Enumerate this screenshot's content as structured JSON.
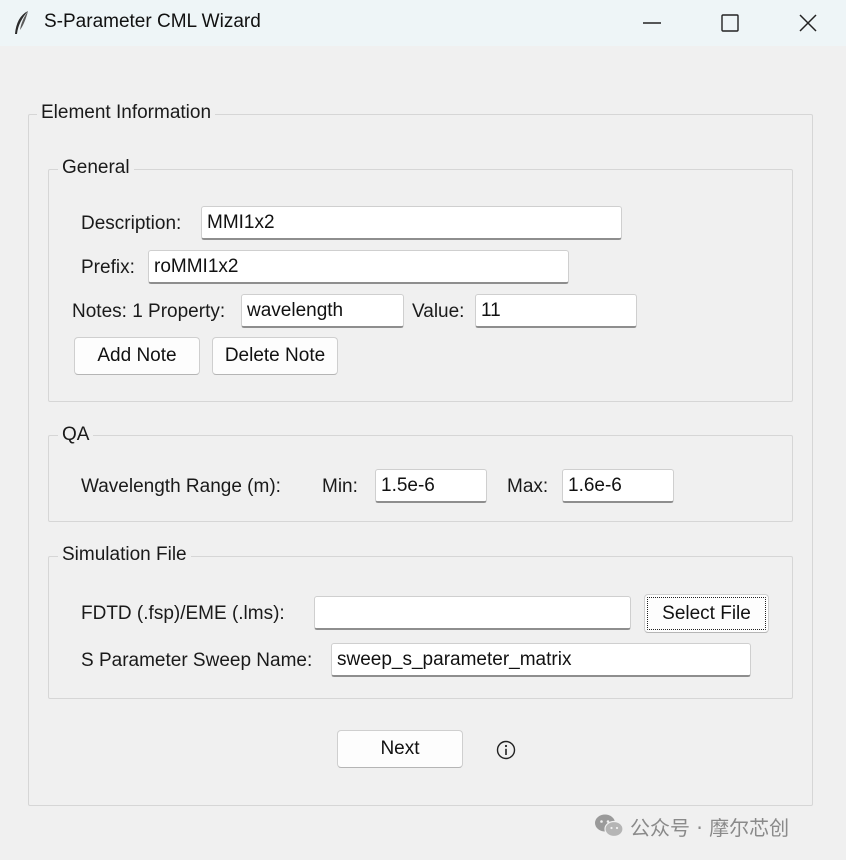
{
  "window": {
    "title": "S-Parameter CML Wizard"
  },
  "element_info": {
    "label": "Element Information",
    "general": {
      "label": "General",
      "description_label": "Description:",
      "description_value": "MMI1x2",
      "prefix_label": "Prefix:",
      "prefix_value": "roMMI1x2",
      "notes_label": "Notes: 1 Property:",
      "property_value": "wavelength",
      "value_label": "Value:",
      "value_value": "11",
      "add_note_label": "Add Note",
      "delete_note_label": "Delete Note"
    },
    "qa": {
      "label": "QA",
      "range_label": "Wavelength Range (m):",
      "min_label": "Min:",
      "min_value": "1.5e-6",
      "max_label": "Max:",
      "max_value": "1.6e-6"
    },
    "simulation": {
      "label": "Simulation File",
      "file_label": "FDTD (.fsp)/EME (.lms):",
      "file_value": "",
      "select_file_label": "Select File",
      "sweep_label": "S Parameter Sweep Name:",
      "sweep_value": "sweep_s_parameter_matrix"
    },
    "next_label": "Next"
  },
  "watermark": {
    "text": "公众号 · 摩尔芯创"
  },
  "icons": {
    "app": "feather-icon",
    "minimize": "minimize-icon",
    "maximize": "maximize-icon",
    "close": "close-icon",
    "info": "info-icon",
    "watermark": "wechat-icon"
  }
}
